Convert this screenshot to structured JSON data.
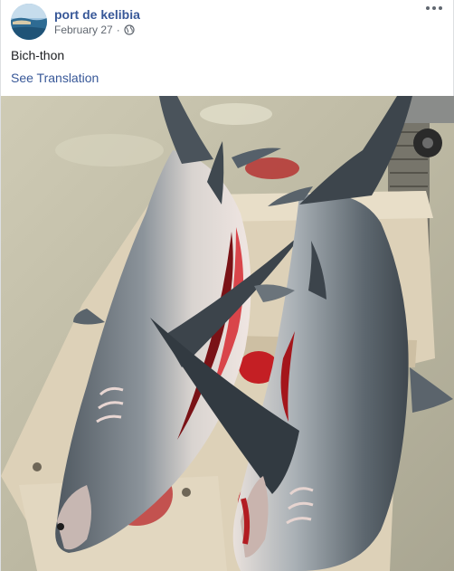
{
  "post": {
    "page_name": "port de kelibia",
    "date": "February 27",
    "separator": "·",
    "privacy_icon": "globe-icon",
    "more_icon": "more-options-icon",
    "text": "Bich-thon",
    "see_translation": "See Translation"
  },
  "photo": {
    "subject": "thresher-sharks-on-pallets"
  },
  "colors": {
    "link": "#385898",
    "secondary_text": "#606770",
    "text": "#1c1e21"
  }
}
